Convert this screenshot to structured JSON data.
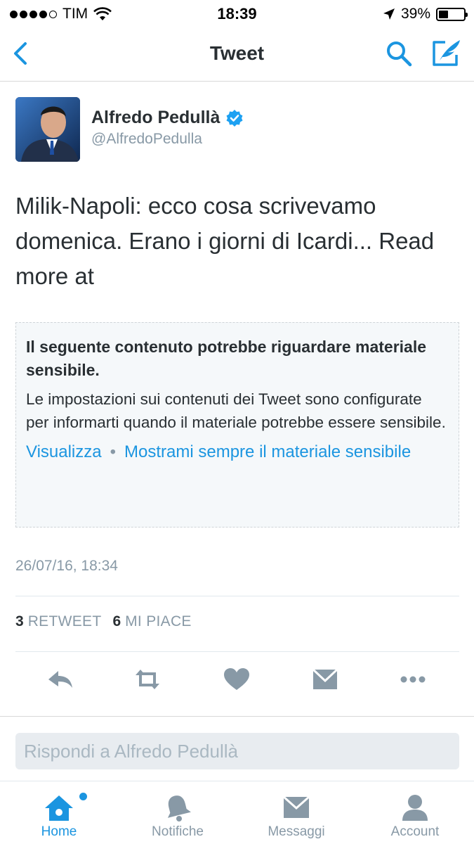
{
  "status_bar": {
    "carrier": "TIM",
    "time": "18:39",
    "battery": "39%",
    "battery_level": 0.39
  },
  "nav": {
    "title": "Tweet",
    "back_icon": "chevron-left-icon",
    "search_icon": "search-icon",
    "compose_icon": "compose-icon",
    "accent_color": "#1b95e0"
  },
  "tweet": {
    "author_name": "Alfredo Pedullà",
    "author_handle": "@AlfredoPedulla",
    "verified": true,
    "text": "Milik-Napoli: ecco cosa scrivevamo domenica. Erano i giorni di Icardi... Read more at",
    "sensitive": {
      "title": "Il seguente contenuto potrebbe riguardare materiale sensibile.",
      "body": "Le impostazioni sui contenuti dei Tweet sono configurate per informarti quando il materiale potrebbe essere sensibile.",
      "view_link": "Visualizza",
      "separator": "•",
      "always_show_link": "Mostrami sempre il materiale sensibile"
    },
    "timestamp": "26/07/16, 18:34",
    "retweet_count": "3",
    "retweet_label": "RETWEET",
    "like_count": "6",
    "like_label": "MI PIACE"
  },
  "actions": [
    "reply-icon",
    "retweet-icon",
    "like-icon",
    "direct-message-icon",
    "more-icon"
  ],
  "reply": {
    "placeholder": "Rispondi a Alfredo Pedullà"
  },
  "tabs": [
    {
      "label": "Home",
      "icon": "home-icon",
      "active": true
    },
    {
      "label": "Notifiche",
      "icon": "bell-icon",
      "active": false
    },
    {
      "label": "Messaggi",
      "icon": "envelope-icon",
      "active": false
    },
    {
      "label": "Account",
      "icon": "person-icon",
      "active": false
    }
  ]
}
